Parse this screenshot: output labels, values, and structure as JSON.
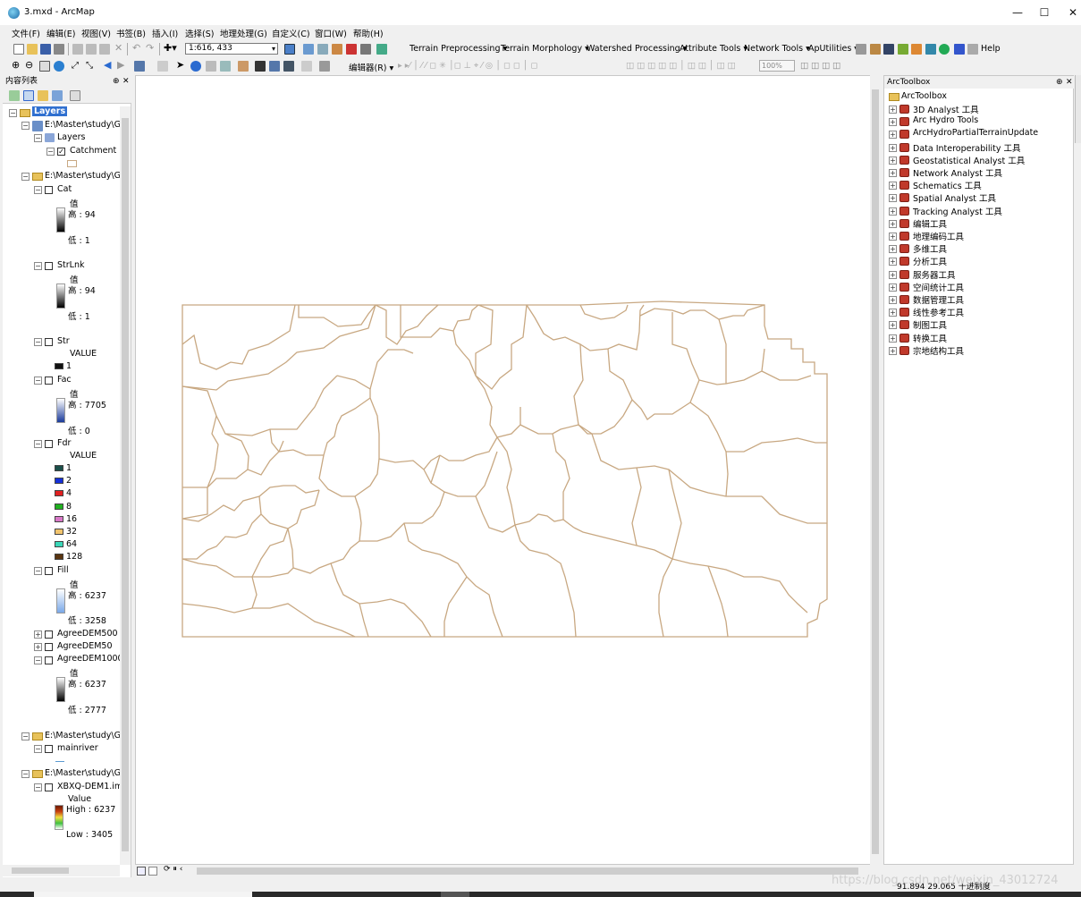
{
  "window": {
    "title": "3.mxd - ArcMap",
    "minimize": "—",
    "maximize": "☐",
    "close": "✕"
  },
  "menu": [
    "文件(F)",
    "编辑(E)",
    "视图(V)",
    "书签(B)",
    "插入(I)",
    "选择(S)",
    "地理处理(G)",
    "自定义(C)",
    "窗口(W)",
    "帮助(H)"
  ],
  "toolbar1": {
    "scale": "1:616, 433",
    "terrain_preprocessing": "Terrain Preprocessing ▾",
    "terrain_morphology": "Terrain Morphology ▾",
    "watershed_processing": "Watershed Processing ▾",
    "attribute_tools": "Attribute Tools ▾",
    "network_tools": "Network Tools ▾",
    "aputilities": "ApUtilities ▾",
    "help": "Help"
  },
  "toolbar2": {
    "editor": "编辑器(R) ▾",
    "zoom": "100%"
  },
  "toc": {
    "title": "内容列表",
    "root": "Layers",
    "group1": {
      "path": "E:\\Master\\study\\GIS",
      "sub": "Layers",
      "layer": "Catchment"
    },
    "group2": {
      "path": "E:\\Master\\study\\GIS",
      "layers": [
        {
          "name": "Cat",
          "field": "值",
          "high": "高 : 94",
          "low": "低 : 1"
        },
        {
          "name": "StrLnk",
          "field": "值",
          "high": "高 : 94",
          "low": "低 : 1"
        },
        {
          "name": "Str",
          "field": "VALUE",
          "value": "1"
        },
        {
          "name": "Fac",
          "field": "值",
          "high": "高 : 7705",
          "low": "低 : 0"
        },
        {
          "name": "Fdr",
          "field": "VALUE"
        },
        {
          "name": "Fill",
          "field": "值",
          "high": "高 : 6237",
          "low": "低 : 3258"
        },
        {
          "name": "AgreeDEM500"
        },
        {
          "name": "AgreeDEM50"
        },
        {
          "name": "AgreeDEM1000",
          "field": "值",
          "high": "高 : 6237",
          "low": "低 : 2777"
        }
      ],
      "fdr_classes": [
        {
          "label": "1",
          "color": "#1b4f4a"
        },
        {
          "label": "2",
          "color": "#1530d8"
        },
        {
          "label": "4",
          "color": "#e02020"
        },
        {
          "label": "8",
          "color": "#20b020"
        },
        {
          "label": "16",
          "color": "#d978c8"
        },
        {
          "label": "32",
          "color": "#f2c46e"
        },
        {
          "label": "64",
          "color": "#3ad7b8"
        },
        {
          "label": "128",
          "color": "#5a3510"
        }
      ]
    },
    "group3": {
      "path": "E:\\Master\\study\\GIS",
      "layer": "mainriver"
    },
    "group4": {
      "path": "E:\\Master\\study\\GIS",
      "layer": "XBXQ-DEM1.img",
      "field": "Value",
      "high": "High : 6237",
      "low": "Low : 3405"
    }
  },
  "arctoolbox": {
    "title": "ArcToolbox",
    "root": "ArcToolbox",
    "items": [
      "3D Analyst 工具",
      "Arc Hydro Tools",
      "ArcHydroPartialTerrainUpdate",
      "Data Interoperability 工具",
      "Geostatistical Analyst 工具",
      "Network Analyst 工具",
      "Schematics 工具",
      "Spatial Analyst 工具",
      "Tracking Analyst 工具",
      "编辑工具",
      "地理编码工具",
      "多维工具",
      "分析工具",
      "服务器工具",
      "空间统计工具",
      "数据管理工具",
      "线性参考工具",
      "制图工具",
      "转换工具",
      "宗地结构工具"
    ]
  },
  "status": {
    "coords": "91.894  29.065 十进制度"
  },
  "watermark": "https://blog.csdn.net/weixin_43012724",
  "colors": {
    "catchment_line": "#c8a882",
    "selected_bg": "#3070d0"
  }
}
